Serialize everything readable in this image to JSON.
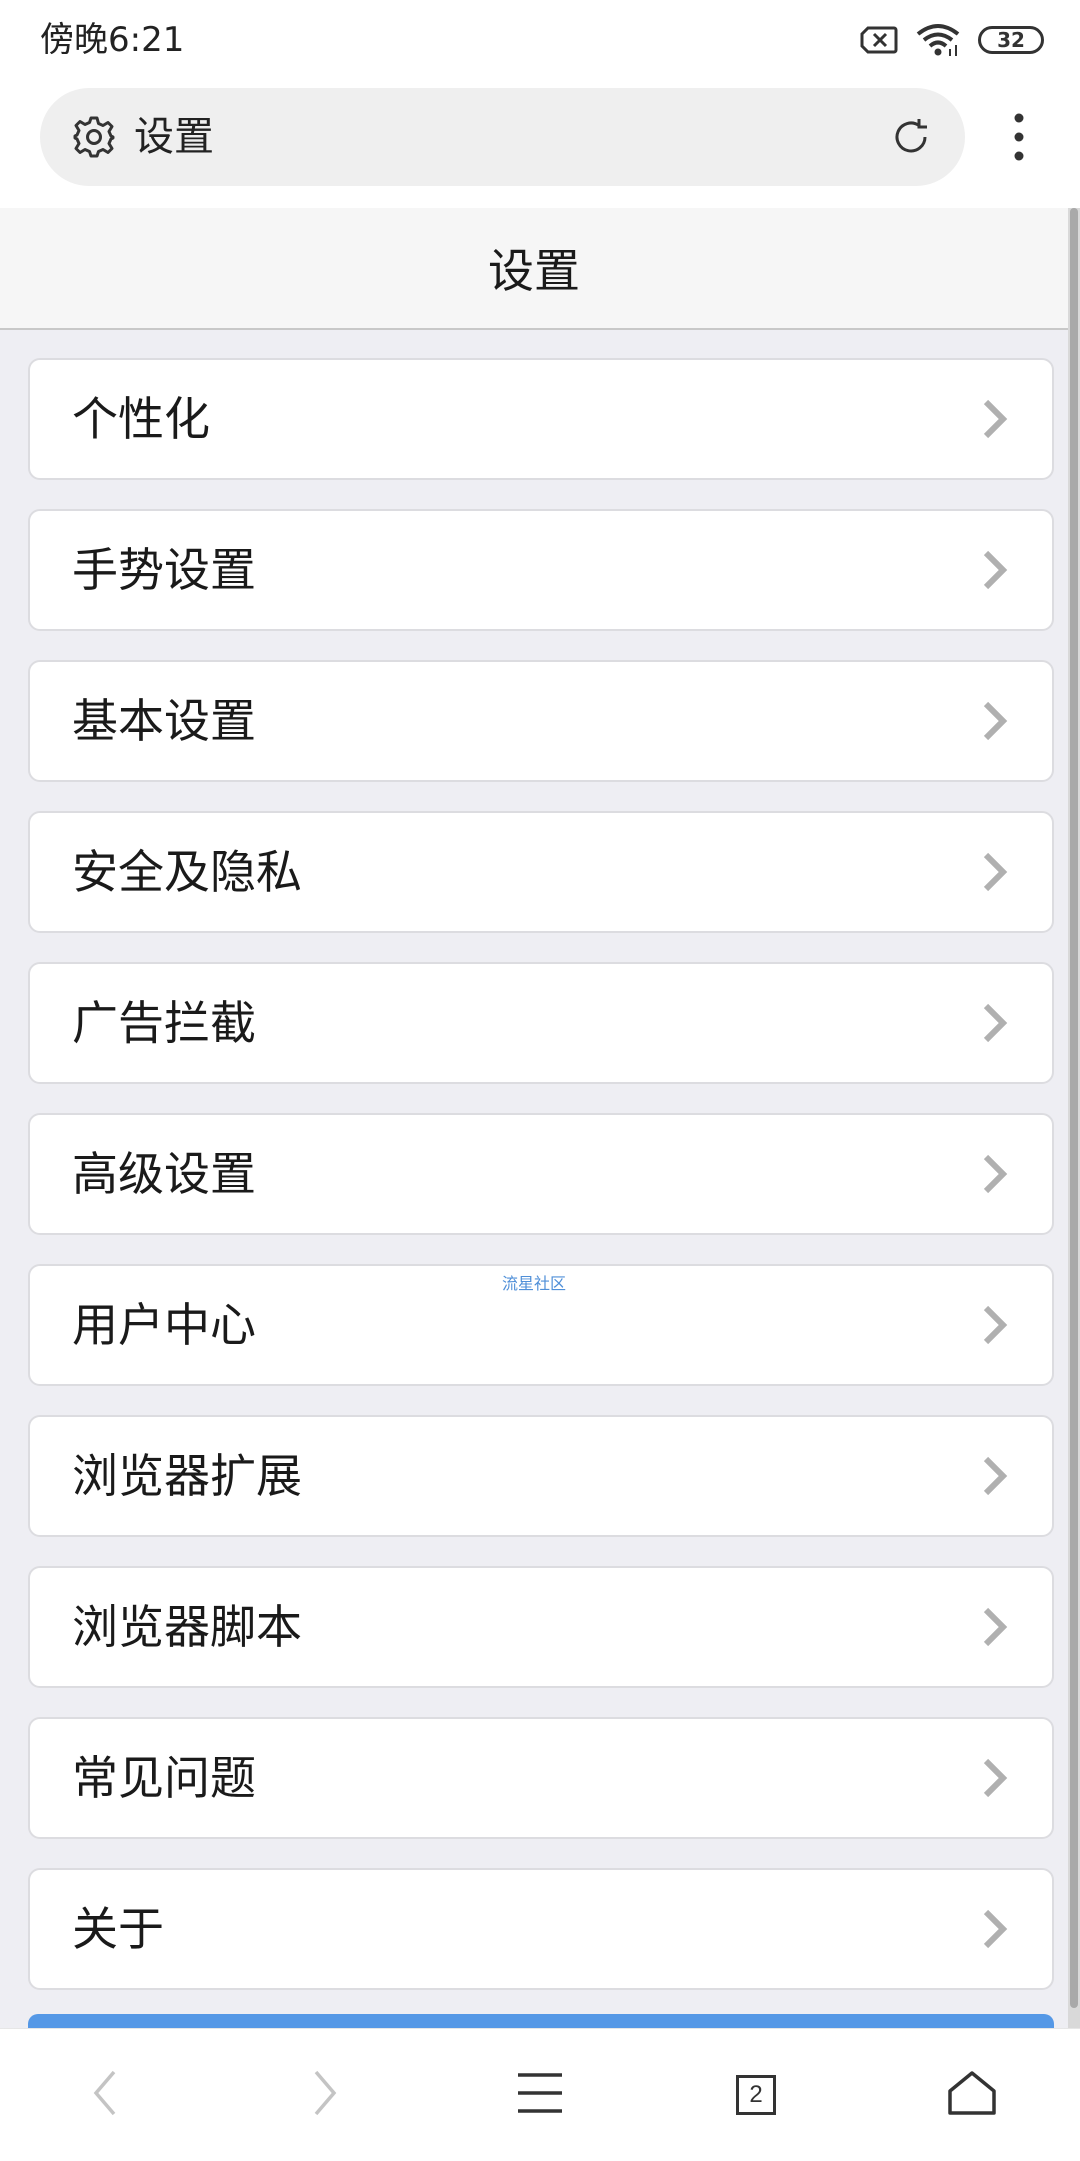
{
  "status_bar": {
    "time": "傍晚6:21",
    "battery": "32",
    "icons": [
      "sim-off-icon",
      "wifi-icon",
      "battery-icon"
    ]
  },
  "address_bar": {
    "text": "设置",
    "left_icon": "gear-icon",
    "right_icon": "reload-icon",
    "menu_icon": "more-vertical-icon"
  },
  "header": {
    "title": "设置"
  },
  "menu": {
    "items": [
      {
        "label": "个性化"
      },
      {
        "label": "手势设置"
      },
      {
        "label": "基本设置"
      },
      {
        "label": "安全及隐私"
      },
      {
        "label": "广告拦截"
      },
      {
        "label": "高级设置"
      },
      {
        "label": "用户中心"
      },
      {
        "label": "浏览器扩展"
      },
      {
        "label": "浏览器脚本"
      },
      {
        "label": "常见问题"
      },
      {
        "label": "关于"
      }
    ]
  },
  "watermark": "流星社区",
  "bottom_nav": {
    "tab_count": "2",
    "icons": [
      "back-icon",
      "forward-icon",
      "menu-icon",
      "tabs-icon",
      "home-icon"
    ]
  },
  "colors": {
    "page_bg": "#eeeef3",
    "accent": "#5598e6",
    "chevron": "#b0b0b0"
  }
}
